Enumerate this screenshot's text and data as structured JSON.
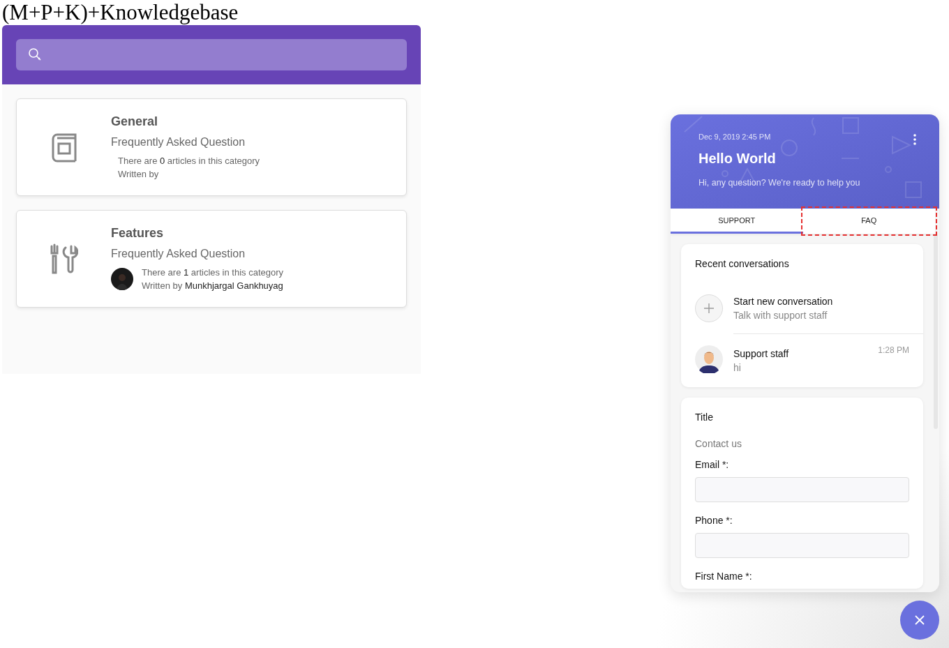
{
  "page_title": "(M+P+K)+Knowledgebase",
  "knowledgebase": {
    "categories": [
      {
        "kind": "book",
        "title": "General",
        "subtitle": "Frequently Asked Question",
        "count_text": "There are **0** articles in this category",
        "author_text": "Written by",
        "author_avatar": false
      },
      {
        "kind": "tools",
        "title": "Features",
        "subtitle": "Frequently Asked Question",
        "count_text": "There are **1** articles in this category",
        "author_text": "Written by **Munkhjargal Gankhuyag**",
        "author_avatar": true
      }
    ]
  },
  "widget": {
    "date": "Dec 9, 2019 2:45 PM",
    "title": "Hello World",
    "subtitle": "Hi, any question? We're ready to help you",
    "tabs": [
      {
        "label": "SUPPORT",
        "selected": true,
        "highlighted": false
      },
      {
        "label": "FAQ",
        "selected": false,
        "highlighted": true
      }
    ],
    "recent": {
      "title": "Recent conversations",
      "new_title": "Start new conversation",
      "new_subtitle": "Talk with support staff",
      "conversations": [
        {
          "name": "Support staff",
          "time": "1:28 PM",
          "message": "hi"
        }
      ]
    },
    "form": {
      "title": "Title",
      "description": "Contact us",
      "fields": [
        {
          "kind": "text-input",
          "label": "Email *:"
        },
        {
          "kind": "text-input",
          "label": "Phone *:"
        },
        {
          "kind": "label",
          "label": "First Name *:"
        }
      ]
    }
  }
}
